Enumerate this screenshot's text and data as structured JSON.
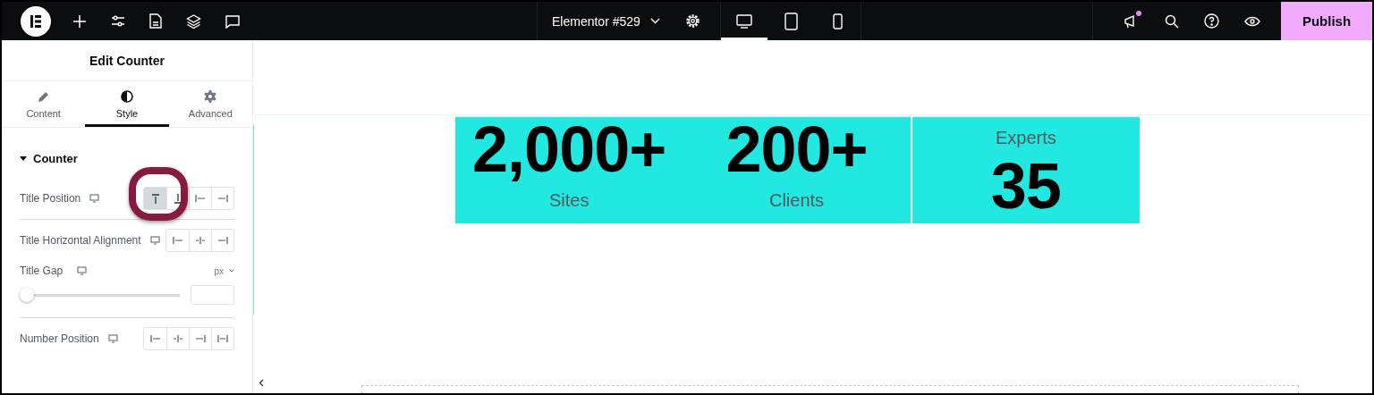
{
  "topbar": {
    "tools": [
      {
        "kind": "add"
      },
      {
        "kind": "settings"
      },
      {
        "kind": "page"
      },
      {
        "kind": "layers"
      },
      {
        "kind": "comments"
      }
    ],
    "document_title": "Elementor #529",
    "devices": [
      {
        "kind": "desktop",
        "selected": true
      },
      {
        "kind": "tablet",
        "selected": false
      },
      {
        "kind": "mobile",
        "selected": false
      }
    ],
    "actions": [
      {
        "kind": "whats-new",
        "badge": true
      },
      {
        "kind": "search",
        "badge": false
      },
      {
        "kind": "help",
        "badge": false
      },
      {
        "kind": "preview",
        "badge": false
      }
    ],
    "publish": "Publish"
  },
  "panel": {
    "title": "Edit Counter",
    "tabs": [
      {
        "label": "Content",
        "kind": "pencil",
        "selected": false
      },
      {
        "label": "Style",
        "kind": "contrast",
        "selected": true
      },
      {
        "label": "Advanced",
        "kind": "gear",
        "selected": false
      }
    ],
    "section": {
      "title": "Counter",
      "expanded": true
    },
    "controls": [
      {
        "kind": "choices",
        "label": "Title Position",
        "divider": true,
        "highlighted": true,
        "options": [
          {
            "kind": "top",
            "selected": true
          },
          {
            "kind": "bottom",
            "selected": false
          },
          {
            "kind": "start",
            "selected": false
          },
          {
            "kind": "end",
            "selected": false
          }
        ]
      },
      {
        "kind": "choices",
        "label": "Title Horizontal Alignment",
        "divider": false,
        "highlighted": false,
        "options": [
          {
            "kind": "start",
            "selected": false
          },
          {
            "kind": "center",
            "selected": false
          },
          {
            "kind": "end",
            "selected": false
          }
        ]
      },
      {
        "kind": "slider",
        "label": "Title Gap",
        "divider": true,
        "unit": "px",
        "level": 0
      },
      {
        "kind": "choices",
        "label": "Number Position",
        "divider": false,
        "highlighted": false,
        "options": [
          {
            "kind": "start",
            "selected": false
          },
          {
            "kind": "center",
            "selected": false
          },
          {
            "kind": "end",
            "selected": false
          },
          {
            "kind": "stretch",
            "selected": false
          }
        ]
      }
    ]
  },
  "canvas": {
    "containers": [
      {
        "counters": [
          {
            "title": "Sites",
            "number": "2,000+",
            "kind": "title-below"
          },
          {
            "title": "Clients",
            "number": "200+",
            "kind": "title-below"
          }
        ]
      },
      {
        "counters": [
          {
            "title": "Experts",
            "number": "35",
            "kind": "title-above"
          }
        ]
      }
    ]
  }
}
